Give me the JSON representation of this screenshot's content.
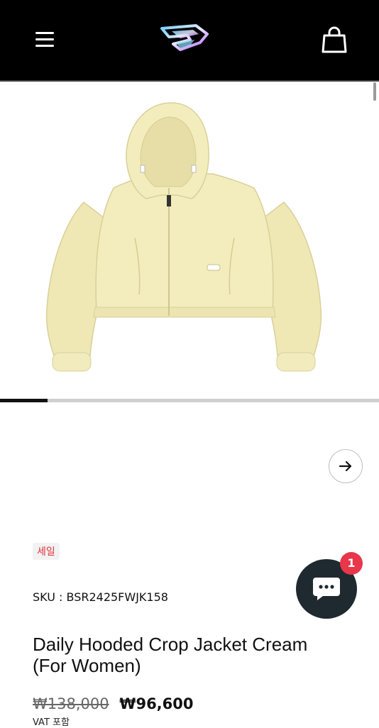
{
  "header": {
    "menu_icon": "hamburger-menu-icon",
    "logo_icon": "brand-logo",
    "cart_icon": "shopping-bag-icon"
  },
  "gallery": {
    "image": "cream-hooded-crop-jacket",
    "progress": 0.125,
    "next_icon": "arrow-right-icon"
  },
  "product": {
    "sale_label": "세일",
    "sku_label": "SKU : BSR2425FWJK158",
    "title": "Daily Hooded Crop Jacket Cream (For Women)",
    "price_original": "₩138,000",
    "price_sale": "₩96,600",
    "vat_note": "VAT 포함"
  },
  "chat": {
    "icon": "chat-bubble-icon",
    "unread_count": "1"
  },
  "colors": {
    "header_bg": "#000000",
    "sale_red": "#e0303a",
    "chat_bg": "#1f2a30",
    "badge_red": "#e8364a",
    "jacket_cream": "#f3edbd"
  }
}
